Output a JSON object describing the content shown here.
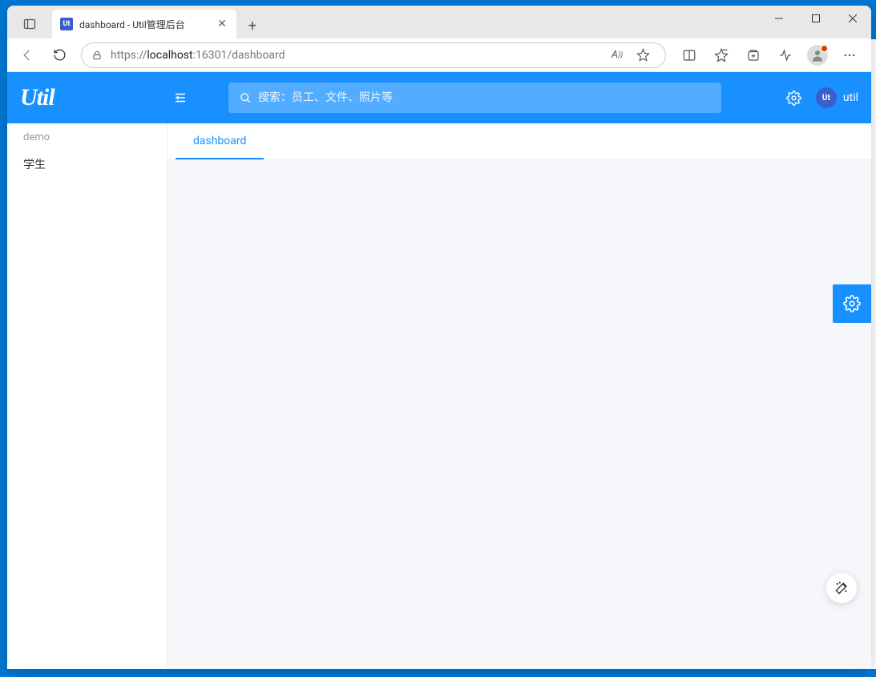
{
  "browser": {
    "tab": {
      "favicon_text": "Ut",
      "title": "dashboard - Util管理后台"
    },
    "url": {
      "prefix": "https://",
      "host": "localhost",
      "suffix": ":16301/dashboard"
    }
  },
  "app": {
    "logo_text": "Util",
    "search_placeholder": "搜索：员工、文件、照片等",
    "user": {
      "avatar_text": "Ut",
      "name": "util"
    }
  },
  "sidebar": {
    "group_label": "demo",
    "items": [
      {
        "label": "学生"
      }
    ]
  },
  "tabs": [
    {
      "label": "dashboard"
    }
  ]
}
